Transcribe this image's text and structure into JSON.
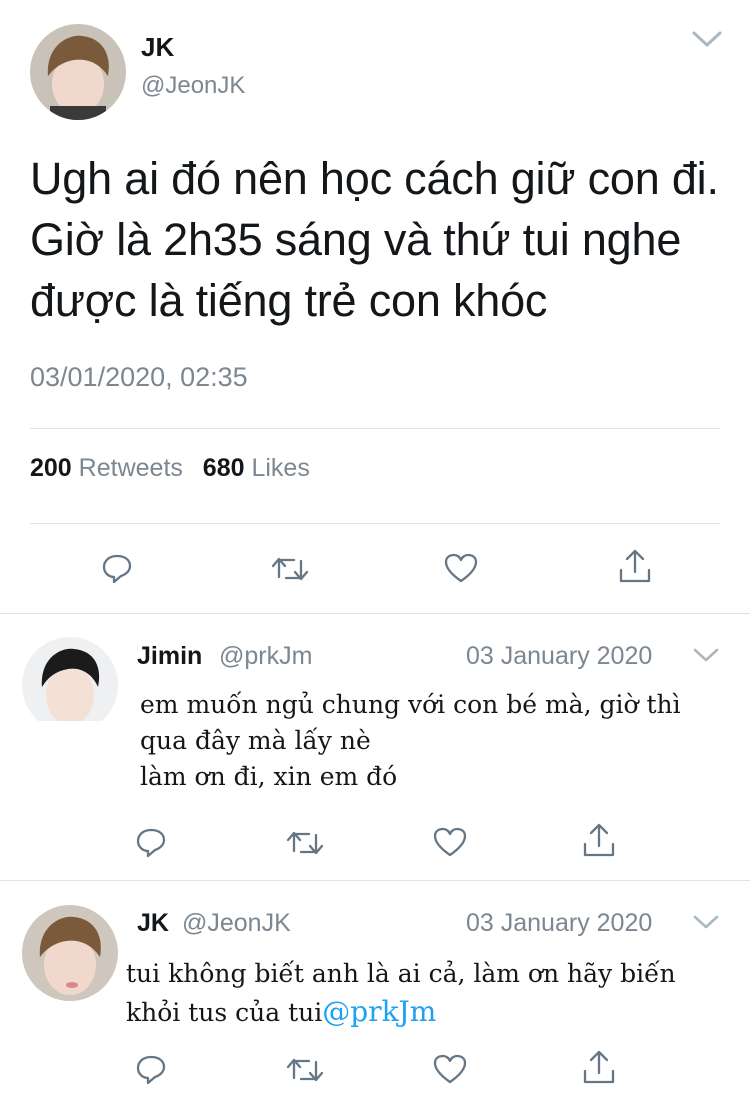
{
  "main_tweet": {
    "display_name": "JK",
    "handle": "@JeonJK",
    "text": "Ugh ai đó nên học cách giữ con đi. Giờ là 2h35 sáng và thứ tui nghe được là tiếng trẻ con khóc",
    "timestamp": "03/01/2020, 02:35",
    "retweet_count": "200",
    "retweet_label": "Retweets",
    "like_count": "680",
    "like_label": "Likes"
  },
  "replies": [
    {
      "display_name": "Jimin",
      "handle": "@prkJm",
      "date": "03 January 2020",
      "lines": [
        "em muốn ngủ chung với con bé mà, giờ thì",
        "qua đây mà lấy nè",
        "làm ơn đi, xin em đó"
      ]
    },
    {
      "display_name": "JK",
      "handle": "@JeonJK",
      "date": "03 January 2020",
      "lines": [
        "tui không biết anh là ai cả, làm ơn hãy biến",
        "khỏi tus của tui"
      ],
      "mention": "@prkJm"
    }
  ],
  "icons": [
    "reply-icon",
    "retweet-icon",
    "like-icon",
    "share-icon",
    "chevron-down-icon"
  ],
  "colors": {
    "link": "#1da1f2",
    "secondary_text": "#7c8791",
    "divider": "#dfe3e6"
  }
}
